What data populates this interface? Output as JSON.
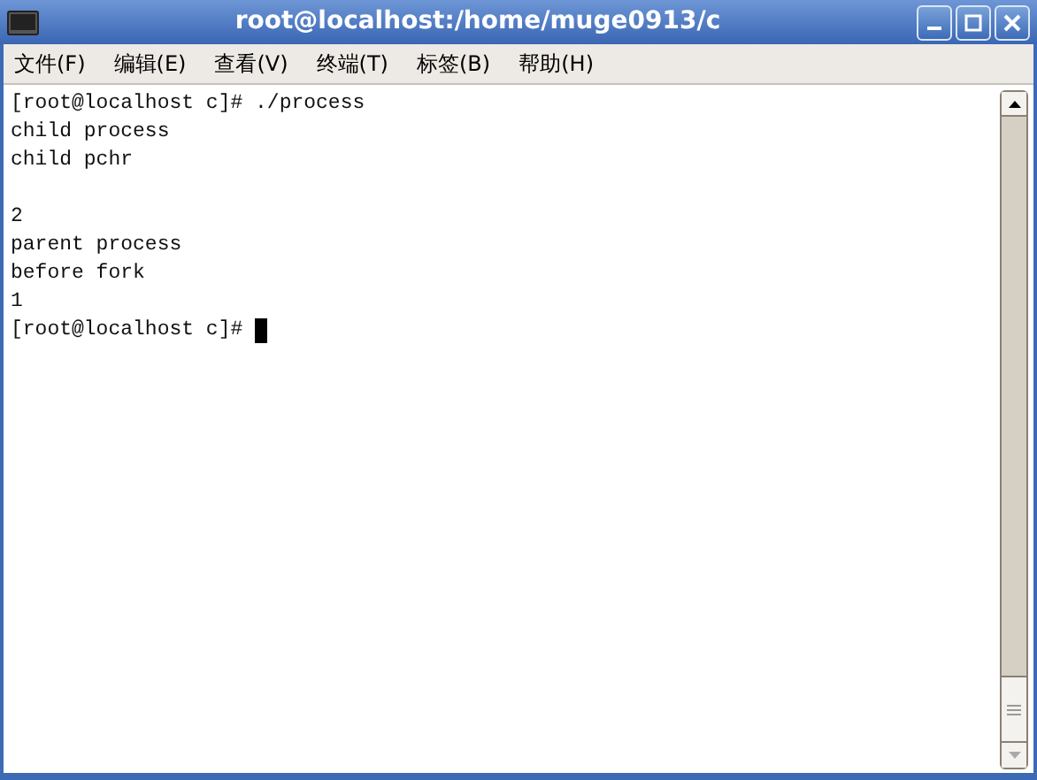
{
  "window": {
    "title": "root@localhost:/home/muge0913/c"
  },
  "menu": [
    "文件(F)",
    "编辑(E)",
    "查看(V)",
    "终端(T)",
    "标签(B)",
    "帮助(H)"
  ],
  "terminal": {
    "lines": [
      {
        "kind": "text",
        "text": "[root@localhost c]# ./process"
      },
      {
        "kind": "text",
        "text": "child process"
      },
      {
        "kind": "text",
        "text": "child pchr"
      },
      {
        "kind": "blank"
      },
      {
        "kind": "text",
        "text": "2"
      },
      {
        "kind": "text",
        "text": "parent process"
      },
      {
        "kind": "text",
        "text": "before fork"
      },
      {
        "kind": "text",
        "text": "1"
      },
      {
        "kind": "prompt",
        "text": "[root@localhost c]#"
      }
    ]
  }
}
